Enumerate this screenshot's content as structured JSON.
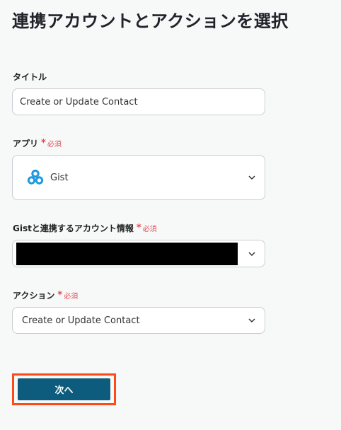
{
  "page": {
    "title": "連携アカウントとアクションを選択"
  },
  "fields": {
    "title_label": "タイトル",
    "title_value": "Create or Update Contact",
    "app_label": "アプリ",
    "app_value": "Gist",
    "app_icon": "gist-logo-icon",
    "account_label": "Gistと連携するアカウント情報",
    "account_value_redacted": true,
    "action_label": "アクション",
    "action_value": "Create or Update Contact",
    "required_mark": "*",
    "required_text": "必須"
  },
  "buttons": {
    "next_label": "次へ"
  },
  "colors": {
    "required": "#e24b54",
    "primary_button": "#0d5c7d",
    "highlight_border": "#ff4a17",
    "gist_brand": "#1e9ae0"
  }
}
